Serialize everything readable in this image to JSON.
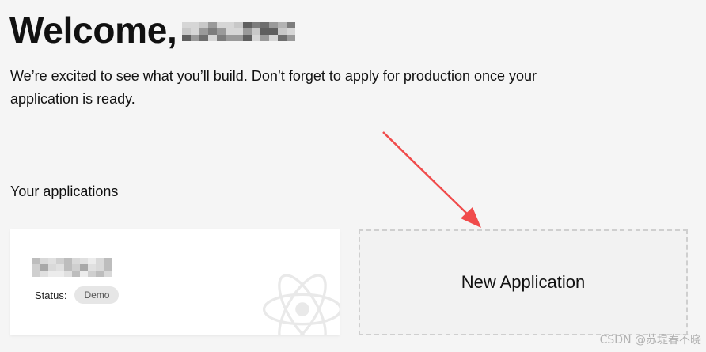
{
  "header": {
    "greeting": "Welcome,",
    "username_redacted": true
  },
  "intro": {
    "text": "We’re excited to see what you’ll build. Don’t forget to apply for production once your application is ready."
  },
  "applications": {
    "section_title": "Your applications",
    "items": [
      {
        "name_redacted": true,
        "status_label": "Status:",
        "status_value": "Demo",
        "logo_icon": "react-atom-icon"
      }
    ],
    "new_button_label": "New Application"
  },
  "annotation": {
    "arrow_color": "#f04b4b"
  },
  "watermark": {
    "text": "CSDN @苏堤春不晓"
  },
  "colors": {
    "background": "#f5f5f5",
    "card_background": "#ffffff",
    "badge_background": "#e6e6e6",
    "dashed_border": "#cfcfcf"
  }
}
